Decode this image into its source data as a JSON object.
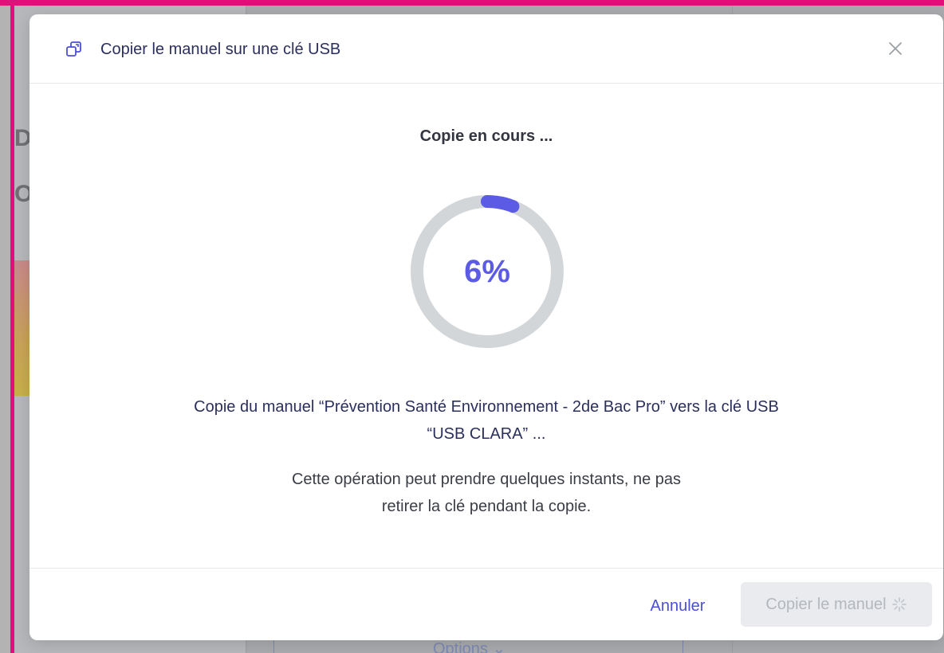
{
  "dialog": {
    "title": "Copier le manuel sur une clé USB",
    "icons": {
      "title": "copy-icon",
      "close": "close-icon",
      "loading": "spinner-icon"
    }
  },
  "progress": {
    "status": "Copie en cours ...",
    "percent": 6,
    "percent_label": "6%",
    "colors": {
      "fill": "#5b5be6",
      "track": "#d3d6d8"
    }
  },
  "message": {
    "line1": "Copie du manuel “Prévention Santé Environnement - 2de Bac Pro” vers la clé USB",
    "line2": "“USB CLARA” ..."
  },
  "warning": {
    "line1": "Cette opération peut prendre quelques instants, ne pas",
    "line2": "retirer la clé pendant la copie."
  },
  "footer": {
    "cancel_label": "Annuler",
    "copy_label": "Copier le manuel"
  },
  "background": {
    "options_label": "Options"
  }
}
